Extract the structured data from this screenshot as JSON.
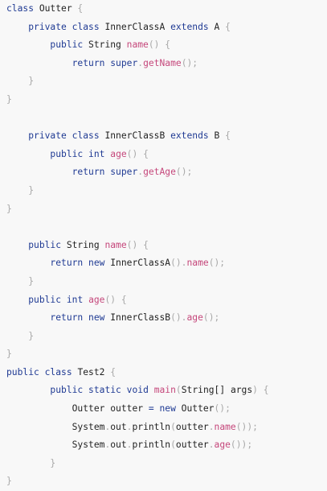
{
  "colors": {
    "background": "#f8f8f8",
    "keyword": "#1f3a93",
    "identifier": "#222222",
    "method": "#c5477b",
    "punctuation": "#a8a8a8",
    "plain": "#3a3a3a"
  },
  "code": {
    "lines": [
      [
        {
          "t": "k",
          "v": "class"
        },
        {
          "t": "i",
          "v": " Outter"
        },
        {
          "t": "p",
          "v": " {"
        }
      ],
      [
        {
          "t": "s",
          "v": "    "
        },
        {
          "t": "k",
          "v": "private"
        },
        {
          "t": "i",
          "v": " "
        },
        {
          "t": "k",
          "v": "class"
        },
        {
          "t": "i",
          "v": " InnerClassA "
        },
        {
          "t": "k",
          "v": "extends"
        },
        {
          "t": "i",
          "v": " A "
        },
        {
          "t": "p",
          "v": "{"
        }
      ],
      [
        {
          "t": "s",
          "v": "        "
        },
        {
          "t": "k",
          "v": "public"
        },
        {
          "t": "i",
          "v": " String "
        },
        {
          "t": "m",
          "v": "name"
        },
        {
          "t": "p",
          "v": "() {"
        }
      ],
      [
        {
          "t": "s",
          "v": "            "
        },
        {
          "t": "k",
          "v": "return"
        },
        {
          "t": "i",
          "v": " "
        },
        {
          "t": "k",
          "v": "super"
        },
        {
          "t": "p",
          "v": "."
        },
        {
          "t": "m",
          "v": "getName"
        },
        {
          "t": "p",
          "v": "();"
        }
      ],
      [
        {
          "t": "s",
          "v": "    "
        },
        {
          "t": "p",
          "v": "}"
        }
      ],
      [
        {
          "t": "p",
          "v": "}"
        }
      ],
      [
        {
          "t": "s",
          "v": ""
        }
      ],
      [
        {
          "t": "s",
          "v": "    "
        },
        {
          "t": "k",
          "v": "private"
        },
        {
          "t": "i",
          "v": " "
        },
        {
          "t": "k",
          "v": "class"
        },
        {
          "t": "i",
          "v": " InnerClassB "
        },
        {
          "t": "k",
          "v": "extends"
        },
        {
          "t": "i",
          "v": " B "
        },
        {
          "t": "p",
          "v": "{"
        }
      ],
      [
        {
          "t": "s",
          "v": "        "
        },
        {
          "t": "k",
          "v": "public"
        },
        {
          "t": "i",
          "v": " "
        },
        {
          "t": "k",
          "v": "int"
        },
        {
          "t": "i",
          "v": " "
        },
        {
          "t": "m",
          "v": "age"
        },
        {
          "t": "p",
          "v": "() {"
        }
      ],
      [
        {
          "t": "s",
          "v": "            "
        },
        {
          "t": "k",
          "v": "return"
        },
        {
          "t": "i",
          "v": " "
        },
        {
          "t": "k",
          "v": "super"
        },
        {
          "t": "p",
          "v": "."
        },
        {
          "t": "m",
          "v": "getAge"
        },
        {
          "t": "p",
          "v": "();"
        }
      ],
      [
        {
          "t": "s",
          "v": "    "
        },
        {
          "t": "p",
          "v": "}"
        }
      ],
      [
        {
          "t": "p",
          "v": "}"
        }
      ],
      [
        {
          "t": "s",
          "v": ""
        }
      ],
      [
        {
          "t": "s",
          "v": "    "
        },
        {
          "t": "k",
          "v": "public"
        },
        {
          "t": "i",
          "v": " String "
        },
        {
          "t": "m",
          "v": "name"
        },
        {
          "t": "p",
          "v": "() {"
        }
      ],
      [
        {
          "t": "s",
          "v": "        "
        },
        {
          "t": "k",
          "v": "return"
        },
        {
          "t": "i",
          "v": " "
        },
        {
          "t": "k",
          "v": "new"
        },
        {
          "t": "i",
          "v": " InnerClassA"
        },
        {
          "t": "p",
          "v": "()."
        },
        {
          "t": "m",
          "v": "name"
        },
        {
          "t": "p",
          "v": "();"
        }
      ],
      [
        {
          "t": "s",
          "v": "    "
        },
        {
          "t": "p",
          "v": "}"
        }
      ],
      [
        {
          "t": "s",
          "v": "    "
        },
        {
          "t": "k",
          "v": "public"
        },
        {
          "t": "i",
          "v": " "
        },
        {
          "t": "k",
          "v": "int"
        },
        {
          "t": "i",
          "v": " "
        },
        {
          "t": "m",
          "v": "age"
        },
        {
          "t": "p",
          "v": "() {"
        }
      ],
      [
        {
          "t": "s",
          "v": "        "
        },
        {
          "t": "k",
          "v": "return"
        },
        {
          "t": "i",
          "v": " "
        },
        {
          "t": "k",
          "v": "new"
        },
        {
          "t": "i",
          "v": " InnerClassB"
        },
        {
          "t": "p",
          "v": "()."
        },
        {
          "t": "m",
          "v": "age"
        },
        {
          "t": "p",
          "v": "();"
        }
      ],
      [
        {
          "t": "s",
          "v": "    "
        },
        {
          "t": "p",
          "v": "}"
        }
      ],
      [
        {
          "t": "p",
          "v": "}"
        }
      ],
      [
        {
          "t": "k",
          "v": "public"
        },
        {
          "t": "i",
          "v": " "
        },
        {
          "t": "k",
          "v": "class"
        },
        {
          "t": "i",
          "v": " Test2 "
        },
        {
          "t": "p",
          "v": "{"
        }
      ],
      [
        {
          "t": "s",
          "v": "        "
        },
        {
          "t": "k",
          "v": "public"
        },
        {
          "t": "i",
          "v": " "
        },
        {
          "t": "k",
          "v": "static"
        },
        {
          "t": "i",
          "v": " "
        },
        {
          "t": "k",
          "v": "void"
        },
        {
          "t": "i",
          "v": " "
        },
        {
          "t": "m",
          "v": "main"
        },
        {
          "t": "p",
          "v": "("
        },
        {
          "t": "i",
          "v": "String[] args"
        },
        {
          "t": "p",
          "v": ") {"
        }
      ],
      [
        {
          "t": "s",
          "v": "            "
        },
        {
          "t": "i",
          "v": "Outter outter "
        },
        {
          "t": "k",
          "v": "="
        },
        {
          "t": "i",
          "v": " "
        },
        {
          "t": "k",
          "v": "new"
        },
        {
          "t": "i",
          "v": " Outter"
        },
        {
          "t": "p",
          "v": "();"
        }
      ],
      [
        {
          "t": "s",
          "v": "            "
        },
        {
          "t": "i",
          "v": "System"
        },
        {
          "t": "p",
          "v": "."
        },
        {
          "t": "i",
          "v": "out"
        },
        {
          "t": "p",
          "v": "."
        },
        {
          "t": "i",
          "v": "println"
        },
        {
          "t": "p",
          "v": "("
        },
        {
          "t": "i",
          "v": "outter"
        },
        {
          "t": "p",
          "v": "."
        },
        {
          "t": "m",
          "v": "name"
        },
        {
          "t": "p",
          "v": "());"
        }
      ],
      [
        {
          "t": "s",
          "v": "            "
        },
        {
          "t": "i",
          "v": "System"
        },
        {
          "t": "p",
          "v": "."
        },
        {
          "t": "i",
          "v": "out"
        },
        {
          "t": "p",
          "v": "."
        },
        {
          "t": "i",
          "v": "println"
        },
        {
          "t": "p",
          "v": "("
        },
        {
          "t": "i",
          "v": "outter"
        },
        {
          "t": "p",
          "v": "."
        },
        {
          "t": "m",
          "v": "age"
        },
        {
          "t": "p",
          "v": "());"
        }
      ],
      [
        {
          "t": "s",
          "v": "        "
        },
        {
          "t": "p",
          "v": "}"
        }
      ],
      [
        {
          "t": "p",
          "v": "}"
        }
      ]
    ]
  }
}
